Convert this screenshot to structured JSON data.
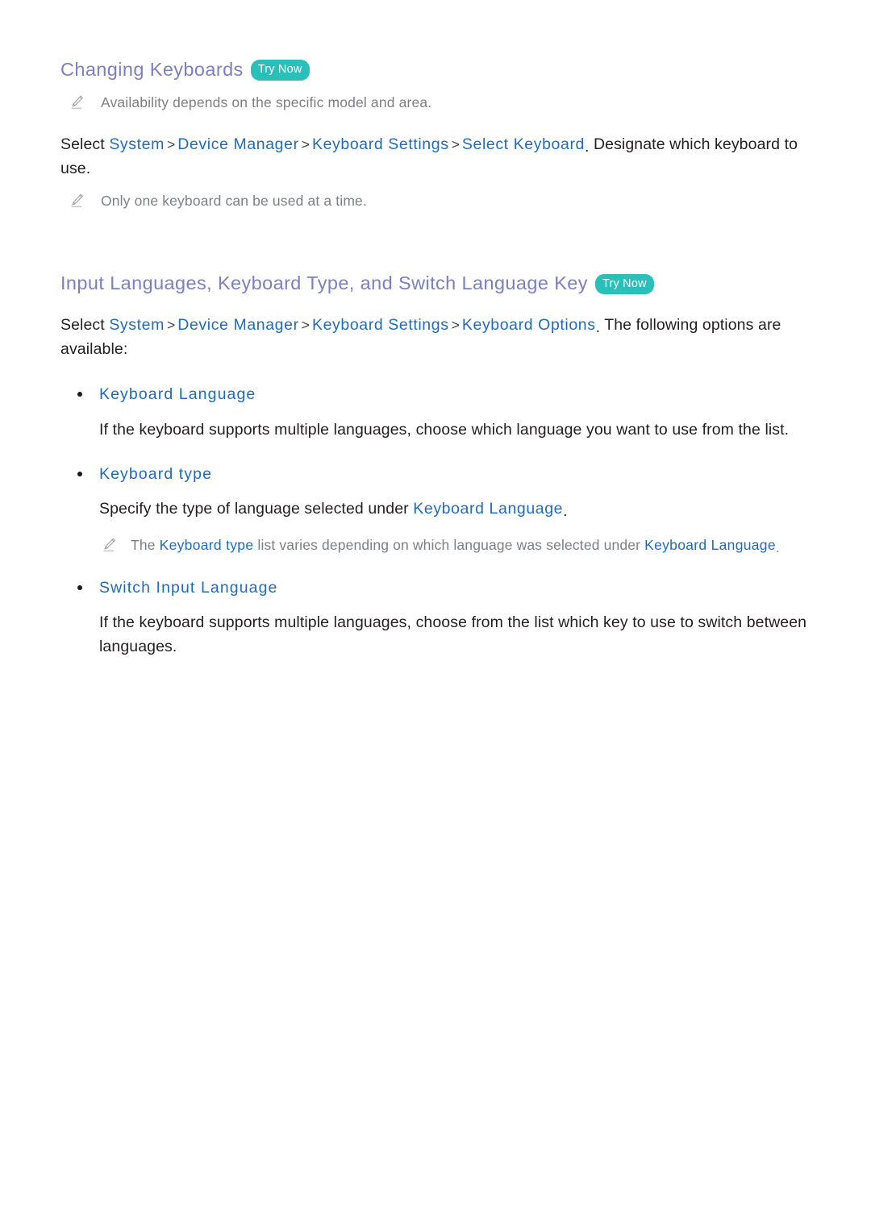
{
  "document": {
    "sections": [
      {
        "heading": "Changing Keyboards",
        "badge": "Try Now",
        "note_top": "Availability depends on the specific model and area.",
        "path": {
          "lead": "Select",
          "items": [
            "System",
            "Device Manager",
            "Keyboard Settings",
            "Select Keyboard"
          ],
          "separator": ">",
          "trailing": "Designate which keyboard to use."
        },
        "note_bottom": "Only one keyboard can be used at a time."
      },
      {
        "heading": "Input Languages, Keyboard Type, and Switch Language Key",
        "badge": "Try Now",
        "path": {
          "lead": "Select",
          "items": [
            "System",
            "Device Manager",
            "Keyboard Settings",
            "Keyboard Options"
          ],
          "separator": ">",
          "trailing": "The following options are available:"
        },
        "options": [
          {
            "label": "Keyboard Language",
            "description": "If the keyboard supports multiple languages, choose which language you want to use from the list."
          },
          {
            "label": "Keyboard type",
            "description_before": "Specify the type of language selected under",
            "description_link": "Keyboard Language",
            "description_after": ".",
            "note": {
              "part1": "The",
              "link1": "Keyboard type",
              "part2": "list varies depending on which language was selected under",
              "link2": "Keyboard Language",
              "part3": "."
            }
          },
          {
            "label": "Switch Input Language",
            "description": "If the keyboard supports multiple languages, choose from the list which key to use to switch between languages."
          }
        ]
      }
    ]
  },
  "icons": {
    "note_icon": "pencil-icon"
  },
  "colors": {
    "heading": "#7b80c4",
    "badge_background": "#2bbfba",
    "badge_text": "#ffffff",
    "link": "#1c6cc4",
    "body_text": "#231f20",
    "note_text": "#7c8084",
    "page_background": "#ffffff"
  }
}
